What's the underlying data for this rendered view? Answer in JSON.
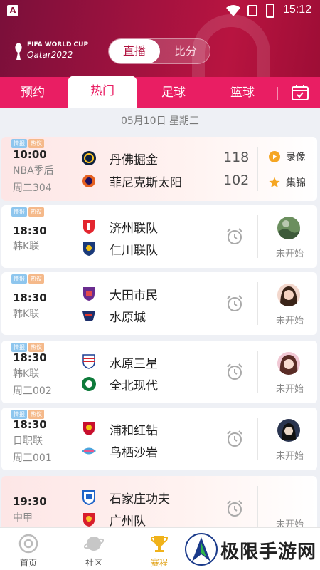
{
  "status_bar": {
    "time": "15:12"
  },
  "header": {
    "logo_line1": "FIFA WORLD CUP",
    "logo_line2": "Qatar2022",
    "segment": {
      "active": "直播",
      "inactive": "比分"
    }
  },
  "tabs": [
    {
      "label": "预约",
      "active": false
    },
    {
      "label": "热门",
      "active": true
    },
    {
      "label": "足球",
      "active": false
    },
    {
      "label": "篮球",
      "active": false
    }
  ],
  "date_header": "05月10日 星期三",
  "tag_labels": {
    "intel": "情报",
    "hot": "热议"
  },
  "matches": [
    {
      "time": "10:00",
      "league": "NBA季后",
      "code": "周二304",
      "home": "丹佛掘金",
      "away": "菲尼克斯太阳",
      "home_score": "118",
      "away_score": "102",
      "actions": [
        "录像",
        "集锦"
      ]
    },
    {
      "time": "18:30",
      "league": "韩K联",
      "code": "",
      "home": "济州联队",
      "away": "仁川联队",
      "status": "未开始"
    },
    {
      "time": "18:30",
      "league": "韩K联",
      "code": "",
      "home": "大田市民",
      "away": "水原城",
      "status": "未开始"
    },
    {
      "time": "18:30",
      "league": "韩K联",
      "code": "周三002",
      "home": "水原三星",
      "away": "全北现代",
      "status": "未开始"
    },
    {
      "time": "18:30",
      "league": "日职联",
      "code": "周三001",
      "home": "浦和红钻",
      "away": "鸟栖沙岩",
      "status": "未开始"
    },
    {
      "time": "19:30",
      "league": "中甲",
      "code": "",
      "home": "石家庄功夫",
      "away": "广州队",
      "status": "未开始"
    }
  ],
  "bottom_nav": [
    {
      "label": "首页",
      "icon": "home-icon"
    },
    {
      "label": "社区",
      "icon": "community-icon"
    },
    {
      "label": "赛程",
      "icon": "trophy-icon",
      "active": true
    }
  ],
  "watermark": "极限手游网",
  "colors": {
    "accent": "#e91e63",
    "header_dark": "#8a1035",
    "nav_active": "#e0a011"
  }
}
